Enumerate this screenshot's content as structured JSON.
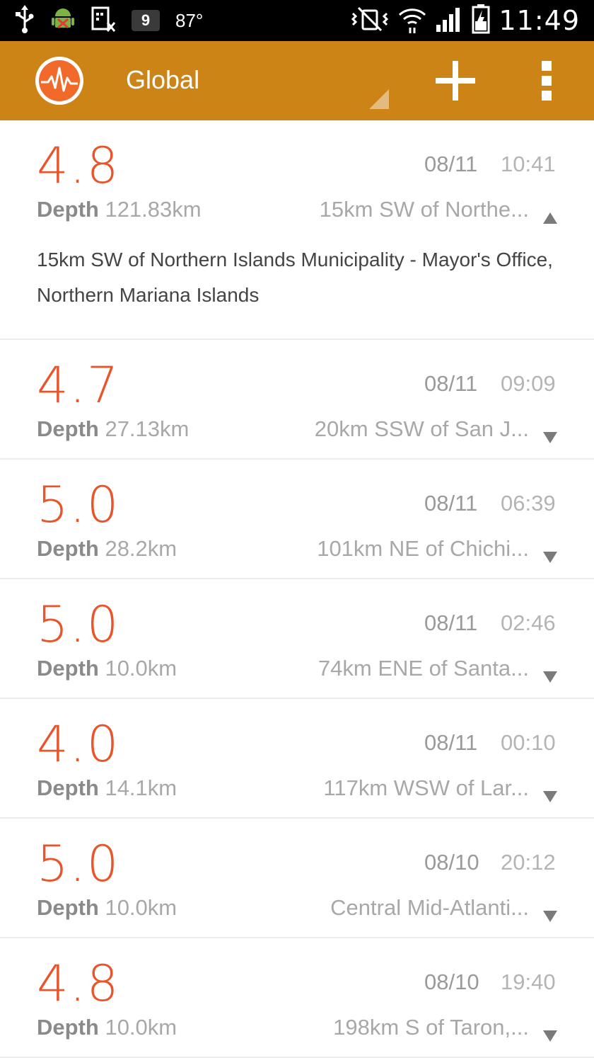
{
  "status_bar": {
    "left_icons": [
      "usb-icon",
      "android-debug-icon",
      "sim-blocked-icon"
    ],
    "notification_count": "9",
    "temperature": "87°",
    "right_icons": [
      "vibrate-mute-icon",
      "wifi-icon",
      "signal-icon",
      "battery-charging-icon"
    ],
    "time": "11:49"
  },
  "action_bar": {
    "logo_icon": "seismograph-logo-icon",
    "title": "Global",
    "add_icon": "plus-icon",
    "overflow_icon": "overflow-menu-icon",
    "color": "#cc8416"
  },
  "colors": {
    "magnitude": "#e8552b",
    "divider": "#ececec"
  },
  "quakes": [
    {
      "magnitude": "4.8",
      "date": "08/11",
      "time": "10:41",
      "depth_label": "Depth",
      "depth": "121.83km",
      "location_short": "15km SW of Northe...",
      "expanded": true,
      "chevron_icon": "chevron-up-icon",
      "location_full": "15km SW of Northern Islands Municipality - Mayor's Office, Northern Mariana Islands"
    },
    {
      "magnitude": "4.7",
      "date": "08/11",
      "time": "09:09",
      "depth_label": "Depth",
      "depth": "27.13km",
      "location_short": "20km SSW of San J...",
      "expanded": false,
      "chevron_icon": "chevron-down-icon"
    },
    {
      "magnitude": "5.0",
      "date": "08/11",
      "time": "06:39",
      "depth_label": "Depth",
      "depth": "28.2km",
      "location_short": "101km NE of Chichi...",
      "expanded": false,
      "chevron_icon": "chevron-down-icon"
    },
    {
      "magnitude": "5.0",
      "date": "08/11",
      "time": "02:46",
      "depth_label": "Depth",
      "depth": "10.0km",
      "location_short": "74km ENE of Santa...",
      "expanded": false,
      "chevron_icon": "chevron-down-icon"
    },
    {
      "magnitude": "4.0",
      "date": "08/11",
      "time": "00:10",
      "depth_label": "Depth",
      "depth": "14.1km",
      "location_short": "117km WSW of Lar...",
      "expanded": false,
      "chevron_icon": "chevron-down-icon"
    },
    {
      "magnitude": "5.0",
      "date": "08/10",
      "time": "20:12",
      "depth_label": "Depth",
      "depth": "10.0km",
      "location_short": "Central Mid-Atlanti...",
      "expanded": false,
      "chevron_icon": "chevron-down-icon"
    },
    {
      "magnitude": "4.8",
      "date": "08/10",
      "time": "19:40",
      "depth_label": "Depth",
      "depth": "10.0km",
      "location_short": "198km S of Taron,...",
      "expanded": false,
      "chevron_icon": "chevron-down-icon"
    }
  ]
}
